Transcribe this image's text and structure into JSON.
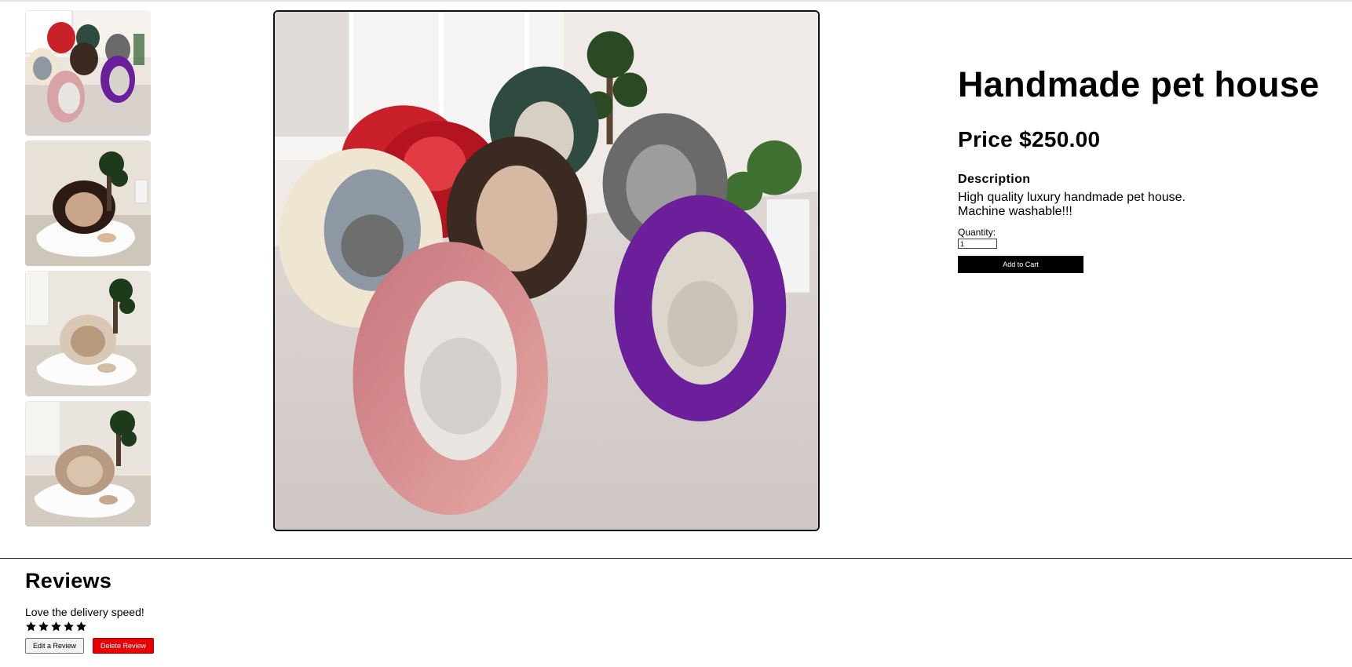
{
  "product": {
    "title": "Handmade pet house",
    "price": "Price $250.00",
    "description_heading": "Description",
    "description_lines": [
      "High quality luxury handmade pet house.",
      "Machine washable!!!"
    ],
    "quantity_label": "Quantity:",
    "quantity_value": "1",
    "add_to_cart_label": "Add to Cart"
  },
  "gallery": {
    "thumbnails": [
      {
        "name": "thumbnail-1",
        "colors": [
          "#c9202a",
          "#2f4a3e",
          "#4a3a33",
          "#6a6a6a",
          "#d7a3a6",
          "#6b1f9a"
        ]
      },
      {
        "name": "thumbnail-2",
        "colors": [
          "#2b1b14"
        ]
      },
      {
        "name": "thumbnail-3",
        "colors": [
          "#d6c2ad"
        ]
      },
      {
        "name": "thumbnail-4",
        "colors": [
          "#b79a84"
        ]
      }
    ],
    "main_image_colors": [
      "#c9202a",
      "#2f4a3e",
      "#4a3a33",
      "#6a6a6a",
      "#d7a3a6",
      "#6b1f9a",
      "#efe6d2"
    ]
  },
  "reviews": {
    "heading": "Reviews",
    "items": [
      {
        "text": "Love the delivery speed!",
        "rating": 5,
        "max_rating": 5
      }
    ],
    "edit_label": "Edit a Review",
    "delete_label": "Delete Review"
  },
  "colors": {
    "accent_delete": "#e80000",
    "cart_button": "#000000"
  }
}
